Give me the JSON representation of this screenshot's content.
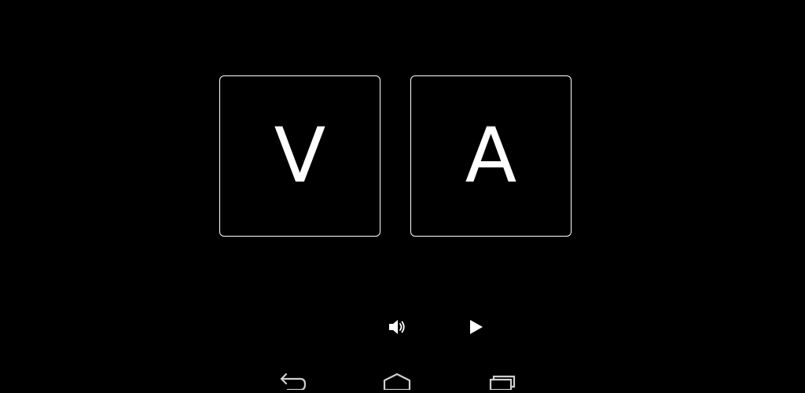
{
  "tiles": {
    "left_letter": "V",
    "right_letter": "A"
  },
  "controls": {
    "sound_icon": "speaker-icon",
    "play_icon": "play-icon"
  },
  "navbar": {
    "back_icon": "back-icon",
    "home_icon": "home-icon",
    "recents_icon": "recents-icon"
  },
  "colors": {
    "background": "#000000",
    "foreground": "#ffffff",
    "nav_icon": "#cfcfcf"
  }
}
